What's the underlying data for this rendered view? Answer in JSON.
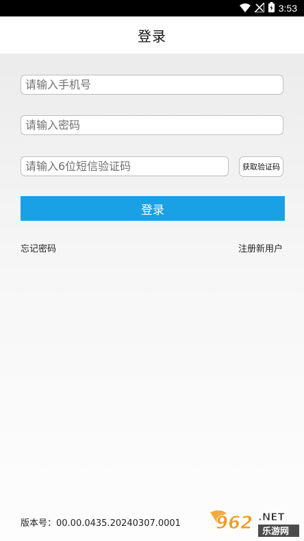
{
  "status_bar": {
    "time": "3:53"
  },
  "header": {
    "title": "登录"
  },
  "form": {
    "phone_placeholder": "请输入手机号",
    "password_placeholder": "请输入密码",
    "sms_code_placeholder": "请输入6位短信验证码",
    "get_code_label": "获取验证码",
    "login_label": "登录"
  },
  "links": {
    "forgot_password": "忘记密码",
    "register": "注册新用户"
  },
  "footer": {
    "version": "版本号：00.00.0435.20240307.0001"
  },
  "watermark": {
    "number": "962",
    "suffix": ".NET",
    "subtitle": "乐游网"
  },
  "colors": {
    "accent": "#1aa0e5",
    "watermark_orange": "#f39a1c"
  }
}
